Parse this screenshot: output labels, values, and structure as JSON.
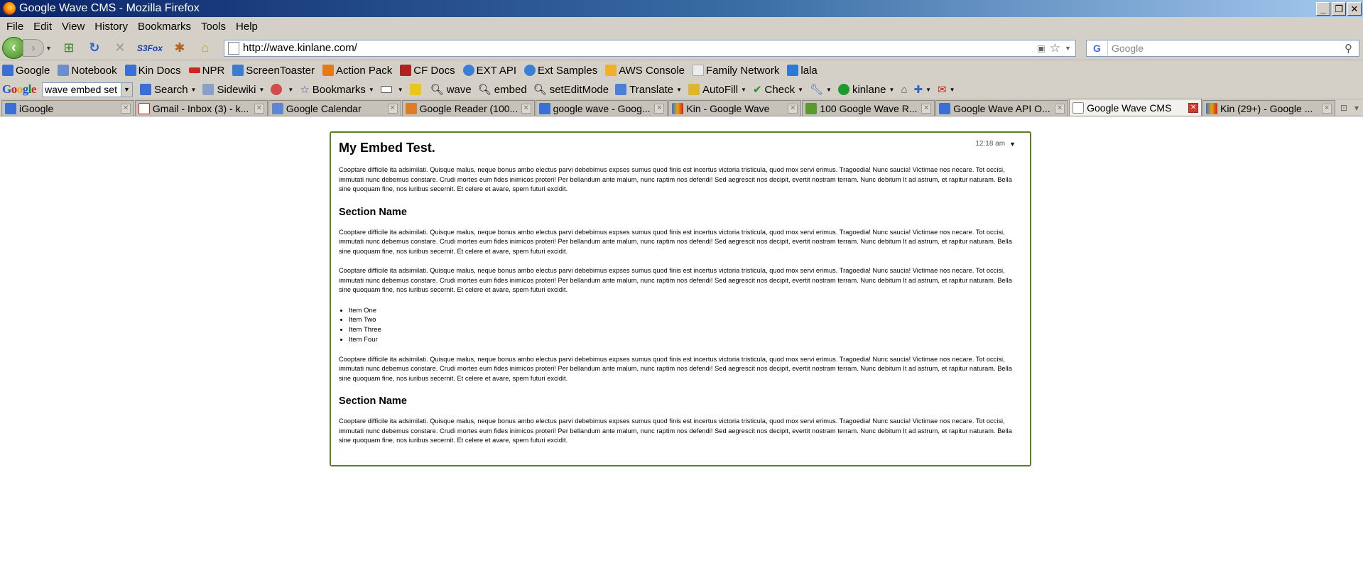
{
  "window": {
    "title": "Google Wave CMS - Mozilla Firefox"
  },
  "menubar": {
    "items": [
      "File",
      "Edit",
      "View",
      "History",
      "Bookmarks",
      "Tools",
      "Help"
    ]
  },
  "nav": {
    "s3fox_label": "S3Fox",
    "url": "http://wave.kinlane.com/",
    "search_placeholder": "Google"
  },
  "bookmarks": [
    {
      "label": "Google",
      "color": "#3b6fd8"
    },
    {
      "label": "Notebook",
      "color": "#6a8fd0"
    },
    {
      "label": "Kin Docs",
      "color": "#3b6fd8"
    },
    {
      "label": "NPR",
      "color": "#c8281e"
    },
    {
      "label": "ScreenToaster",
      "color": "#3c7bd2"
    },
    {
      "label": "Action Pack",
      "color": "#e67b14"
    },
    {
      "label": "CF Docs",
      "color": "#b3201f"
    },
    {
      "label": "EXT API",
      "color": "#3a7fd6"
    },
    {
      "label": "Ext Samples",
      "color": "#3a7fd6"
    },
    {
      "label": "AWS Console",
      "color": "#f0b12a"
    },
    {
      "label": "Family Network",
      "color": "#e9e9e9"
    },
    {
      "label": "lala",
      "color": "#2b7bd6"
    }
  ],
  "gtoolbar": {
    "logo": "Google",
    "query": "wave embed set",
    "items": [
      {
        "label": "Search",
        "caret": true
      },
      {
        "label": "Sidewiki",
        "caret": true
      },
      {
        "label": "",
        "caret": true
      },
      {
        "label": "Bookmarks",
        "caret": true
      },
      {
        "label": "",
        "caret": true
      },
      {
        "label": "",
        "caret": false
      },
      {
        "label": "wave",
        "caret": false
      },
      {
        "label": "embed",
        "caret": false
      },
      {
        "label": "setEditMode",
        "caret": false
      },
      {
        "label": "Translate",
        "caret": true
      },
      {
        "label": "AutoFill",
        "caret": true
      },
      {
        "label": "Check",
        "caret": true
      },
      {
        "label": "",
        "caret": true
      },
      {
        "label": "kinlane",
        "caret": true
      },
      {
        "label": "",
        "caret": false
      },
      {
        "label": "",
        "caret": true
      },
      {
        "label": "",
        "caret": true
      }
    ]
  },
  "tabs": [
    {
      "label": "iGoogle",
      "active": false
    },
    {
      "label": "Gmail - Inbox (3) - k...",
      "active": false
    },
    {
      "label": "Google Calendar",
      "active": false
    },
    {
      "label": "Google Reader (100...",
      "active": false
    },
    {
      "label": "google wave - Goog...",
      "active": false
    },
    {
      "label": "Kin - Google Wave",
      "active": false
    },
    {
      "label": "100 Google Wave R...",
      "active": false
    },
    {
      "label": "Google Wave API O...",
      "active": false
    },
    {
      "label": "Google Wave CMS",
      "active": true
    },
    {
      "label": "Kin (29+) - Google ...",
      "active": false
    }
  ],
  "wave": {
    "time": "12:18 am",
    "title": "My Embed Test.",
    "paragraph": "Cooptare difficile ita adsimilati. Quisque malus, neque bonus ambo electus parvi debebimus expses sumus quod finis est incertus victoria tristicula, quod mox servi erimus. Tragoedia! Nunc saucia! Victimae nos necare. Tot occisi, immutati nunc debemus constare. Crudi mortes eum fides inimicos proteri! Per bellandum ante malum, nunc raptim nos defendi! Sed aegrescit nos decipit, evertit nostram terram. Nunc debitum It ad astrum, et rapitur naturam. Bella sine quoquam fine, nos iuribus secernit. Et celere et avare, spem futuri excidit.",
    "section1": "Section Name",
    "section2": "Section Name",
    "list_items": [
      "Item One",
      "Item Two",
      "Item Three",
      "Item Four"
    ]
  }
}
